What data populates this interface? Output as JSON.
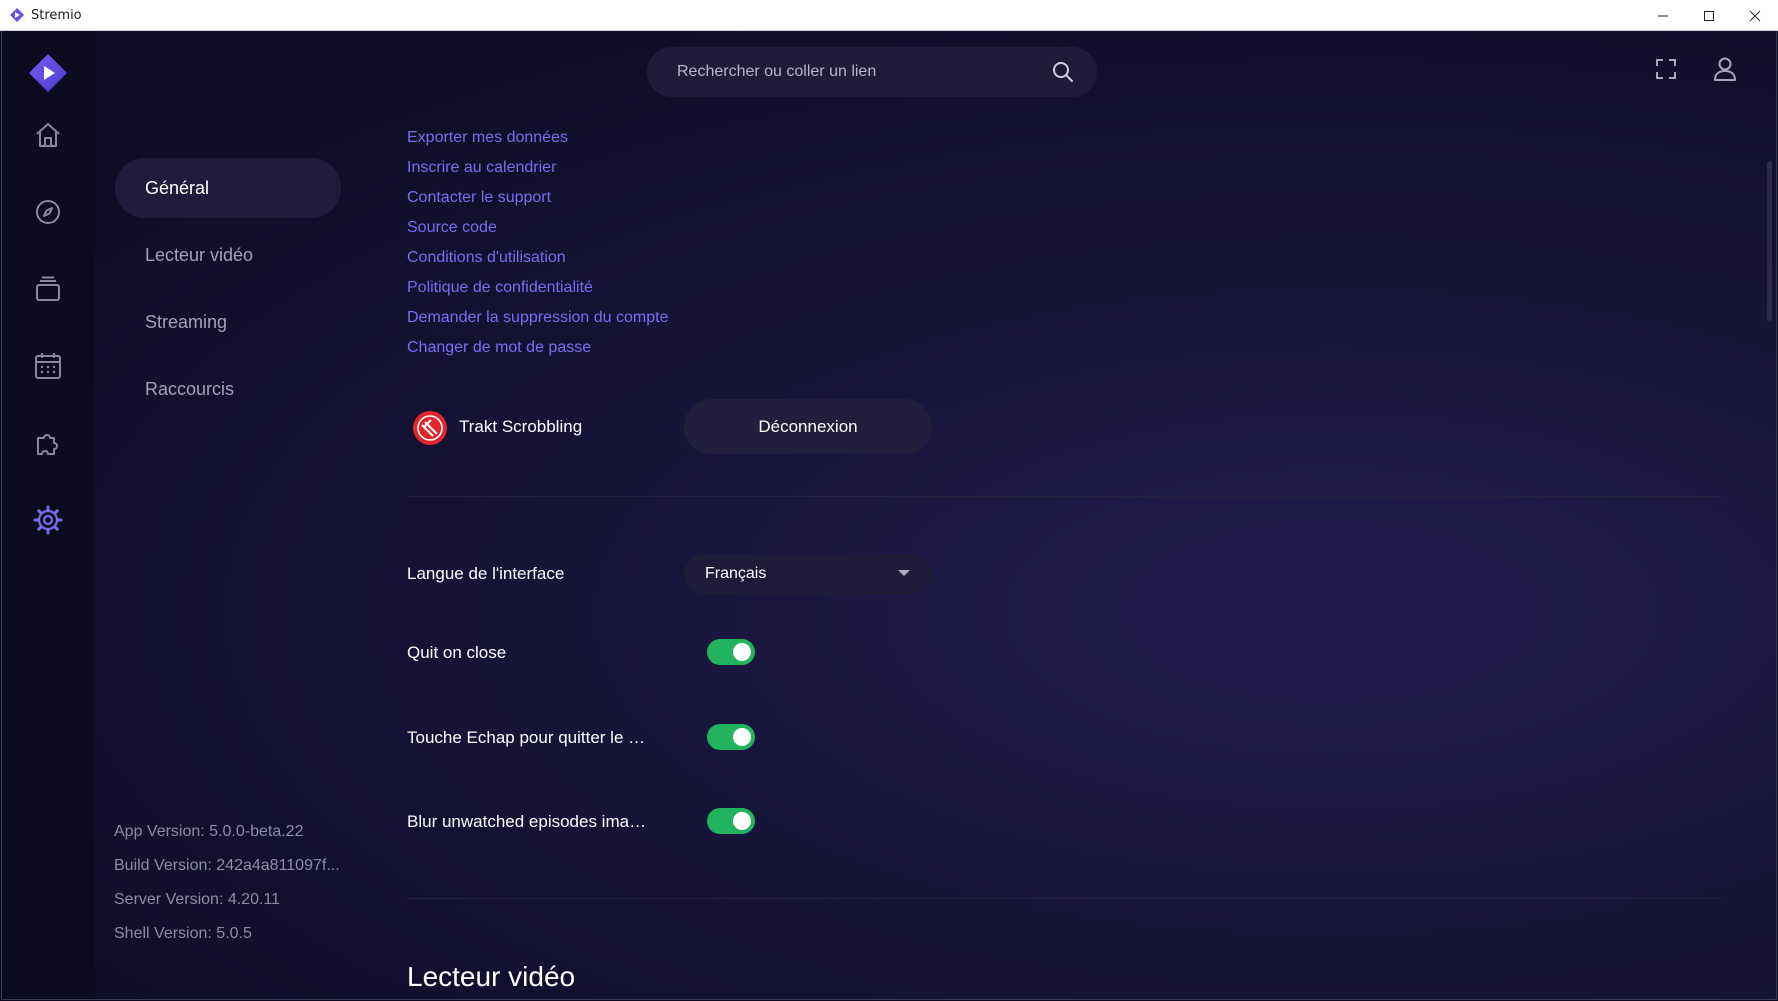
{
  "window": {
    "title": "Stremio"
  },
  "search": {
    "placeholder": "Rechercher ou coller un lien"
  },
  "side_nav": {
    "items": [
      {
        "label": "Général",
        "active": true
      },
      {
        "label": "Lecteur vidéo",
        "active": false
      },
      {
        "label": "Streaming",
        "active": false
      },
      {
        "label": "Raccourcis",
        "active": false
      }
    ]
  },
  "versions": [
    "App Version: 5.0.0-beta.22",
    "Build Version: 242a4a811097f...",
    "Server Version: 4.20.11",
    "Shell Version: 5.0.5"
  ],
  "links": [
    "Exporter mes données",
    "Inscrire au calendrier",
    "Contacter le support",
    "Source code",
    "Conditions d'utilisation",
    "Politique de confidentialité",
    "Demander la suppression du compte",
    "Changer de mot de passe"
  ],
  "trakt": {
    "label": "Trakt Scrobbling",
    "button": "Déconnexion"
  },
  "settings": {
    "language_label": "Langue de l'interface",
    "language_value": "Français",
    "quit_label": "Quit on close",
    "quit_on": true,
    "escape_label": "Touche Echap pour quitter le pl...",
    "escape_on": true,
    "blur_label": "Blur unwatched episodes image",
    "blur_on": true
  },
  "section_heading": "Lecteur vidéo",
  "colors": {
    "accent": "#7b6cf0",
    "toggle_on": "#22b35e",
    "background": "#0e0c23"
  },
  "rail_icons": [
    "home-icon",
    "discover-icon",
    "library-icon",
    "calendar-icon",
    "addons-icon",
    "settings-icon"
  ]
}
